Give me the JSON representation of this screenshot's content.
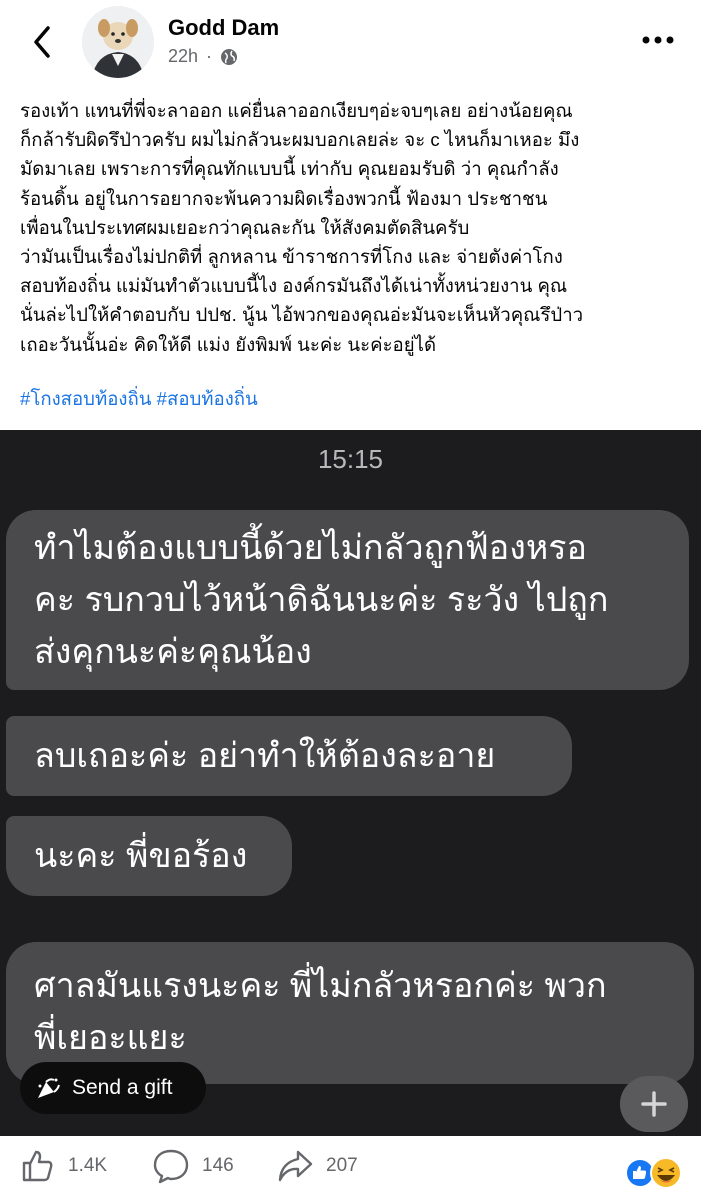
{
  "header": {
    "name": "Godd Dam",
    "time": "22h"
  },
  "post": {
    "lines": [
      "รองเท้า แทนที่พี่จะลาออก แค่ยื่นลาออกเงียบๆอ่ะจบๆเลย  อย่างน้อยคุณ",
      "ก็กล้ารับผิดรึป่าวครับ ผมไม่กลัวนะผมบอกเลยล่ะ จะ c ไหนก็มาเหอะ มึง",
      "มัดมาเลย เพราะการที่คุณทักแบบนี้ เท่ากับ คุณยอมรับดิ ว่า คุณกำลัง",
      "ร้อนดิ้น อยู่ในการอยากจะพ้นความผิดเรื่องพวกนี้ ฟ้องมา ประชาชน",
      "เพื่อนในประเทศผมเยอะกว่าคุณละกัน ให้สังคมตัดสินครับ",
      "ว่ามันเป็นเรื่องไม่ปกติที่ ลูกหลาน ข้าราชการที่โกง และ จ่ายตังค่าโกง",
      "สอบท้องถิ่น แม่มันทำตัวแบบนี้ไง องค์กรมันถึงได้เน่าทั้งหน่วยงาน คุณ",
      "นั่นล่ะไปให้คำตอบกับ ปปช. นู้น ไอ้พวกของคุณอ่ะมันจะเห็นหัวคุณรึป่าว",
      "เถอะวันนั้นอ่ะ คิดให้ดี แม่ง ยังพิมพ์ นะค่ะ นะค่ะอยู่ได้"
    ],
    "hashtags": [
      "#โกงสอบท้องถิ่น",
      "#สอบท้องถิ่น"
    ]
  },
  "chat": {
    "time": "15:15",
    "bubble1": [
      "ทำไมต้องแบบนี้ด้วยไม่กลัวถูกฟ้องหรอ",
      "คะ รบกวบไว้หน้าดิฉันนะค่ะ ระวัง ไปถูก",
      "ส่งคุกนะค่ะคุณน้อง"
    ],
    "bubble2": "ลบเถอะค่ะ อย่าทำให้ต้องละอาย",
    "bubble3": "นะคะ พี่ขอร้อง",
    "bubble4": [
      "ศาลมันแรงนะคะ พี่ไม่กลัวหรอกค่ะ พวก",
      "พี่เยอะแยะ"
    ],
    "gift_label": "Send a gift"
  },
  "stats": {
    "likes": "1.4K",
    "comments": "146",
    "shares": "207"
  },
  "icons": [
    "back-chevron-icon",
    "globe-icon",
    "more-icon",
    "gift-icon",
    "plus-icon",
    "like-icon",
    "comment-icon",
    "share-icon",
    "like-reaction-icon",
    "haha-reaction-icon"
  ],
  "colors": {
    "hashtag": "#1b74e4",
    "chat_bg": "#1c1c1e",
    "bubble": "#4a4a4d",
    "meta": "#65676b"
  }
}
